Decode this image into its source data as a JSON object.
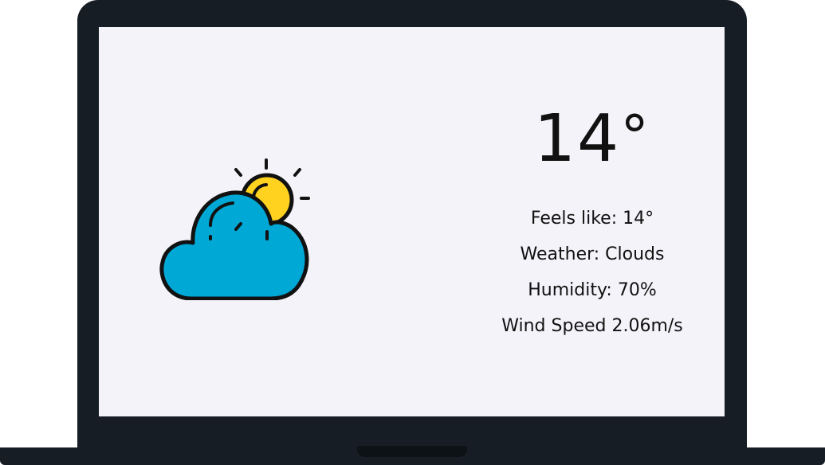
{
  "weather": {
    "temperature": "14",
    "temperature_unit_symbol": "°",
    "feels_like": "Feels like: 14°",
    "condition": "Weather: Clouds",
    "humidity": "Humidity: 70%",
    "wind_speed": "Wind Speed 2.06m/s",
    "icon": "partly-cloudy-icon"
  },
  "colors": {
    "laptop_frame": "#171d24",
    "screen_background": "#f4f3f9",
    "cloud_fill": "#00a8d6",
    "cloud_shade": "#0590c0",
    "sun_fill": "#ffd21f",
    "outline": "#111111"
  }
}
